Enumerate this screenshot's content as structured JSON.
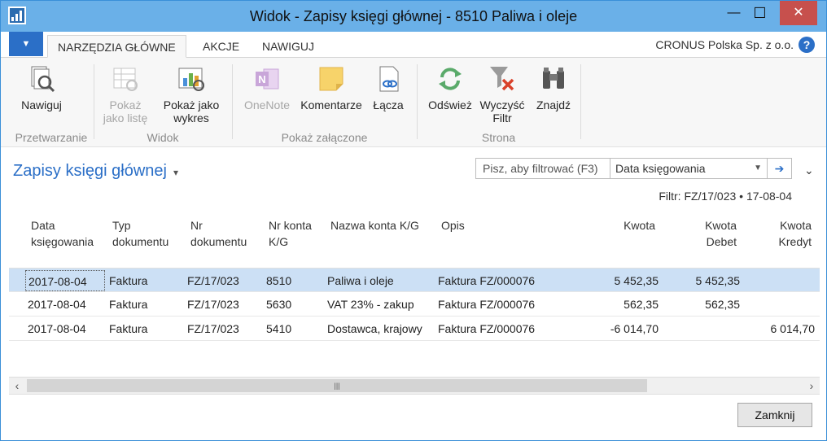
{
  "window": {
    "title": "Widok - Zapisy księgi głównej - 8510 Paliwa i oleje",
    "minimize": "—",
    "maximize": "☐",
    "close": "✕"
  },
  "ribbon": {
    "tabs": [
      "NARZĘDZIA GŁÓWNE",
      "AKCJE",
      "NAWIGUJ"
    ],
    "company": "CRONUS Polska Sp. z o.o.",
    "help": "?",
    "buttons": {
      "navigate": "Nawiguj",
      "show_list_1": "Pokaż",
      "show_list_2": "jako listę",
      "show_chart_1": "Pokaż jako",
      "show_chart_2": "wykres",
      "onenote": "OneNote",
      "comments": "Komentarze",
      "links": "Łącza",
      "refresh": "Odśwież",
      "clear_filter_1": "Wyczyść",
      "clear_filter_2": "Filtr",
      "find": "Znajdź"
    },
    "groups": {
      "process": "Przetwarzanie",
      "view": "Widok",
      "attachments": "Pokaż załączone",
      "page": "Strona"
    }
  },
  "page": {
    "title": "Zapisy księgi głównej",
    "filter_placeholder": "Pisz, aby filtrować (F3)",
    "filter_field": "Data księgowania",
    "filter_summary": "Filtr: FZ/17/023 • 17-08-04"
  },
  "table": {
    "headers": {
      "date_1": "Data",
      "date_2": "księgowania",
      "doctype_1": "Typ",
      "doctype_2": "dokumentu",
      "docno_1": "Nr",
      "docno_2": "dokumentu",
      "acc_1": "Nr konta",
      "acc_2": "K/G",
      "accname": "Nazwa konta K/G",
      "desc": "Opis",
      "amount": "Kwota",
      "debit_1": "Kwota",
      "debit_2": "Debet",
      "credit_1": "Kwota",
      "credit_2": "Kredyt"
    },
    "rows": [
      {
        "date": "2017-08-04",
        "doctype": "Faktura",
        "docno": "FZ/17/023",
        "acc": "8510",
        "accname": "Paliwa i oleje",
        "desc": "Faktura FZ/000076",
        "amount": "5 452,35",
        "debit": "5 452,35",
        "credit": ""
      },
      {
        "date": "2017-08-04",
        "doctype": "Faktura",
        "docno": "FZ/17/023",
        "acc": "5630",
        "accname": "VAT 23% - zakup",
        "desc": "Faktura FZ/000076",
        "amount": "562,35",
        "debit": "562,35",
        "credit": ""
      },
      {
        "date": "2017-08-04",
        "doctype": "Faktura",
        "docno": "FZ/17/023",
        "acc": "5410",
        "accname": "Dostawca, krajowy",
        "desc": "Faktura FZ/000076",
        "amount": "-6 014,70",
        "debit": "",
        "credit": "6 014,70"
      }
    ]
  },
  "footer": {
    "close_label": "Zamknij"
  }
}
